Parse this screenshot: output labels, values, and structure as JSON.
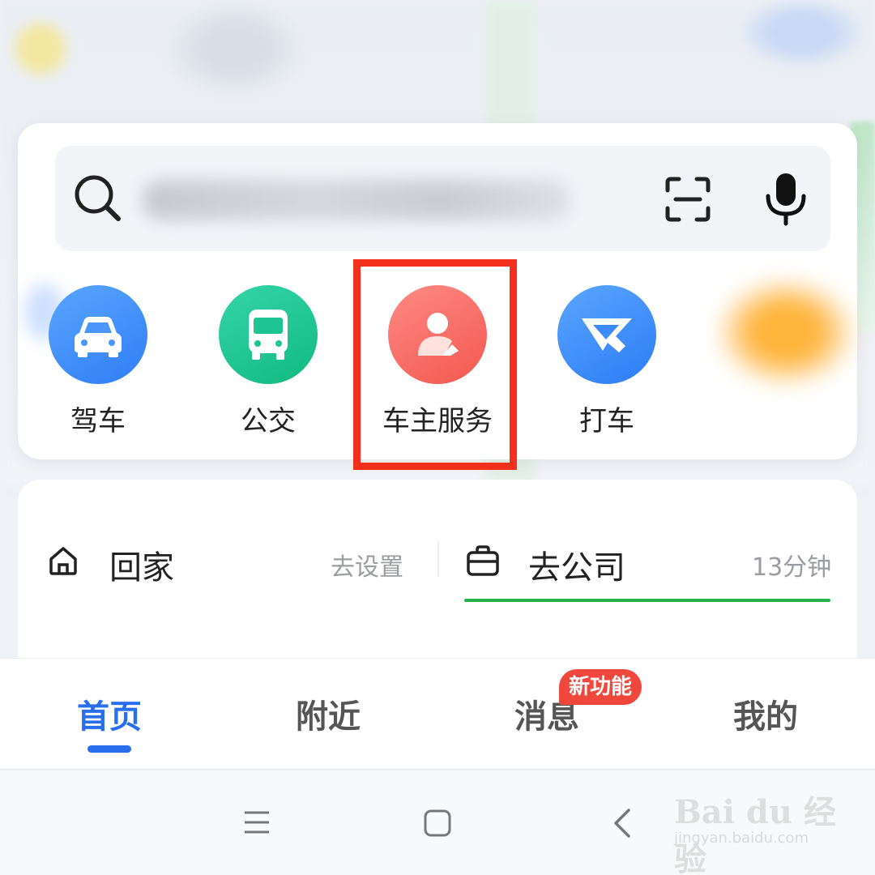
{
  "search": {
    "placeholder_hidden": true
  },
  "shortcuts": [
    {
      "label": "驾车",
      "icon": "car-icon",
      "color": "#3b8cf8"
    },
    {
      "label": "公交",
      "icon": "bus-icon",
      "color": "#1ec491"
    },
    {
      "label": "车主服务",
      "icon": "car-owner-icon",
      "color": "#f76860"
    },
    {
      "label": "打车",
      "icon": "taxi-icon",
      "color": "#3b8cf8"
    }
  ],
  "routes": {
    "home": {
      "label": "回家",
      "action": "去设置"
    },
    "work": {
      "label": "去公司",
      "time": "13分钟"
    }
  },
  "tabs": {
    "home": "首页",
    "nearby": "附近",
    "messages": "消息",
    "me": "我的",
    "badge": "新功能"
  },
  "watermark": {
    "logo": "Bai du 经验",
    "url": "jingyan.baidu.com"
  },
  "colors": {
    "highlight": "#f3301c",
    "accent": "#2a6ef0",
    "route_line": "#24b04c",
    "badge": "#f0473c"
  }
}
